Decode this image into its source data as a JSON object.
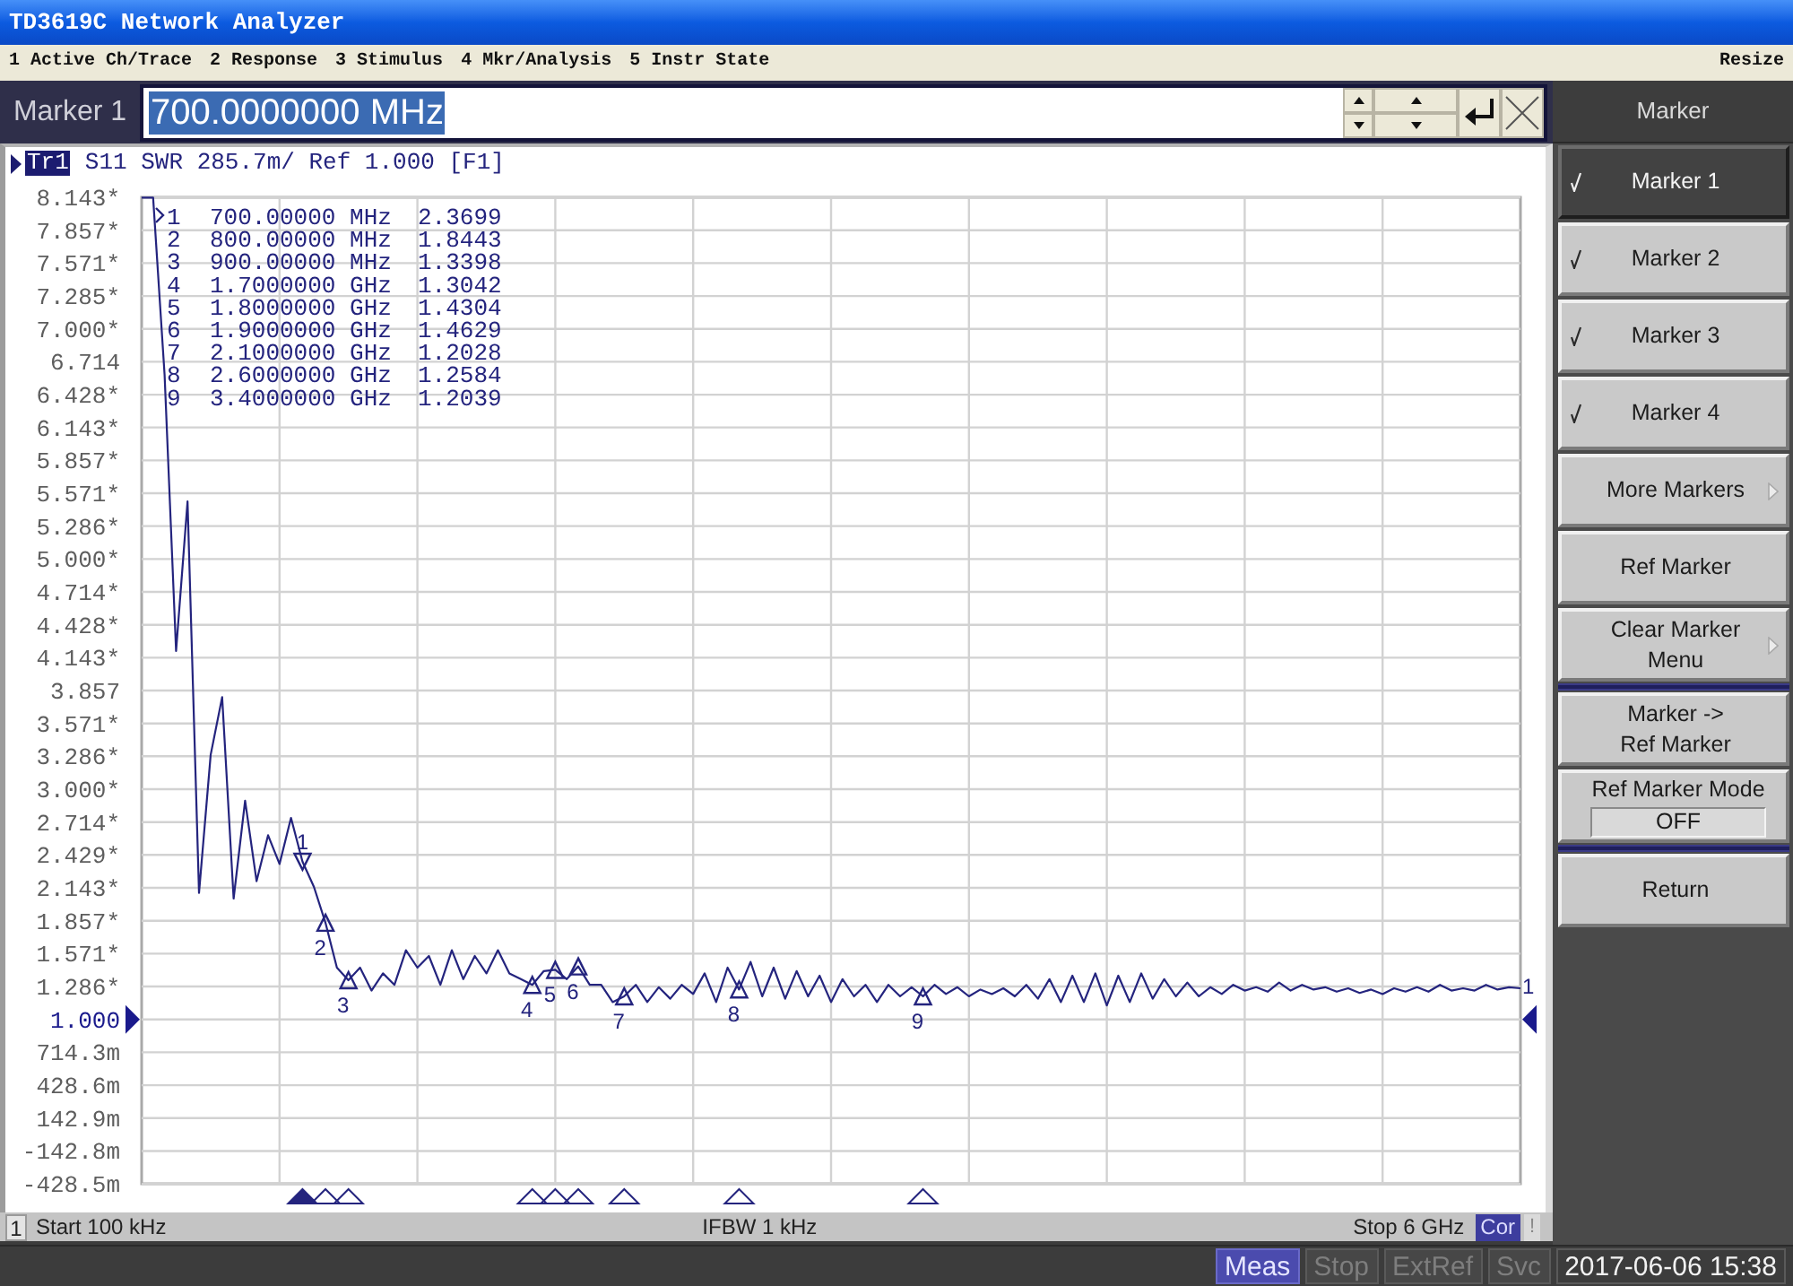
{
  "window": {
    "title": "TD3619C Network Analyzer"
  },
  "menu_bar": {
    "items": [
      "1 Active Ch/Trace",
      "2 Response",
      "3 Stimulus",
      "4 Mkr/Analysis",
      "5 Instr State"
    ],
    "resize": "Resize"
  },
  "entry_bar": {
    "label": "Marker 1",
    "value": "700.0000000 MHz",
    "value_selected": true
  },
  "trace_header": {
    "active": true,
    "trace": "Tr1",
    "info": "S11 SWR 285.7m/ Ref 1.000 [F1]"
  },
  "marker_table": [
    {
      "number": "1",
      "stimulus": "700.00000 MHz",
      "value": "2.3699",
      "active": true
    },
    {
      "number": "2",
      "stimulus": "800.00000 MHz",
      "value": "1.8443",
      "active": false
    },
    {
      "number": "3",
      "stimulus": "900.00000 MHz",
      "value": "1.3398",
      "active": false
    },
    {
      "number": "4",
      "stimulus": "1.7000000 GHz",
      "value": "1.3042",
      "active": false
    },
    {
      "number": "5",
      "stimulus": "1.8000000 GHz",
      "value": "1.4304",
      "active": false
    },
    {
      "number": "6",
      "stimulus": "1.9000000 GHz",
      "value": "1.4629",
      "active": false
    },
    {
      "number": "7",
      "stimulus": "2.1000000 GHz",
      "value": "1.2028",
      "active": false
    },
    {
      "number": "8",
      "stimulus": "2.6000000 GHz",
      "value": "1.2584",
      "active": false
    },
    {
      "number": "9",
      "stimulus": "3.4000000 GHz",
      "value": "1.2039",
      "active": false
    }
  ],
  "chart_data": [
    {
      "type": "line",
      "ylim": [
        -0.4285,
        8.143
      ],
      "tick_labels": "y",
      "grid": true,
      "categories": [
        null,
        null,
        null,
        null,
        null,
        null,
        null,
        null,
        null,
        null,
        null,
        null,
        null,
        null,
        null,
        null,
        null,
        null,
        null,
        null,
        null,
        null,
        null,
        null,
        null,
        null,
        null,
        null,
        null,
        null,
        null,
        null,
        null,
        null,
        null,
        null,
        null,
        null,
        null,
        null,
        null,
        null,
        null,
        null,
        null,
        null,
        null,
        null,
        null,
        null,
        null,
        null,
        null,
        null,
        null,
        null,
        null,
        null,
        null,
        null,
        null,
        null,
        null,
        null,
        null,
        null,
        null,
        null,
        null,
        null,
        null,
        null,
        null,
        null,
        null,
        null,
        null,
        null,
        null,
        null,
        null,
        null,
        null,
        null,
        null,
        null,
        null,
        null,
        null,
        null,
        null,
        null,
        null,
        null,
        null,
        null,
        null,
        null,
        null,
        null,
        null,
        null,
        null,
        null,
        null,
        null,
        null,
        null,
        null,
        null,
        null,
        null,
        null,
        null,
        null,
        null,
        null,
        null,
        null,
        null,
        null
      ],
      "yticks": [
        {
          "value": 8.143,
          "label": "8.143*"
        },
        {
          "value": 7.857,
          "label": "7.857*"
        },
        {
          "value": 7.571,
          "label": "7.571*"
        },
        {
          "value": 7.285,
          "label": "7.285*"
        },
        {
          "value": 7,
          "label": "7.000*"
        },
        {
          "value": 6.714,
          "label": "6.714"
        },
        {
          "value": 6.428,
          "label": "6.428*"
        },
        {
          "value": 6.143,
          "label": "6.143*"
        },
        {
          "value": 5.857,
          "label": "5.857*"
        },
        {
          "value": 5.571,
          "label": "5.571*"
        },
        {
          "value": 5.286,
          "label": "5.286*"
        },
        {
          "value": 5,
          "label": "5.000*"
        },
        {
          "value": 4.714,
          "label": "4.714*"
        },
        {
          "value": 4.428,
          "label": "4.428*"
        },
        {
          "value": 4.143,
          "label": "4.143*"
        },
        {
          "value": 3.857,
          "label": "3.857"
        },
        {
          "value": 3.571,
          "label": "3.571*"
        },
        {
          "value": 3.286,
          "label": "3.286*"
        },
        {
          "value": 3,
          "label": "3.000*"
        },
        {
          "value": 2.714,
          "label": "2.714*"
        },
        {
          "value": 2.429,
          "label": "2.429*"
        },
        {
          "value": 2.143,
          "label": "2.143*"
        },
        {
          "value": 1.857,
          "label": "1.857*"
        },
        {
          "value": 1.571,
          "label": "1.571*"
        },
        {
          "value": 1.286,
          "label": "1.286*"
        },
        {
          "value": 1,
          "label": "1.000"
        }
      ],
      "annotations": [
        "1",
        "2",
        "3",
        "4",
        "5",
        "6",
        "7",
        "8",
        "9"
      ],
      "series": [
        {
          "name": "1",
          "type": "line",
          "color": "#24247e",
          "values": [
            8.14,
            8.14,
            6.6,
            4.2,
            5.5,
            2.1,
            3.3,
            3.8,
            2.05,
            2.9,
            2.2,
            2.6,
            2.35,
            2.75,
            2.37,
            2.15,
            1.84,
            1.45,
            1.34,
            1.45,
            1.25,
            1.4,
            1.3,
            1.6,
            1.45,
            1.55,
            1.3,
            1.6,
            1.35,
            1.55,
            1.4,
            1.6,
            1.4,
            1.35,
            1.3,
            1.42,
            1.43,
            1.35,
            1.46,
            1.3,
            1.3,
            1.15,
            1.2,
            1.3,
            1.15,
            1.28,
            1.18,
            1.3,
            1.22,
            1.4,
            1.15,
            1.45,
            1.26,
            1.5,
            1.2,
            1.45,
            1.18,
            1.42,
            1.2,
            1.38,
            1.15,
            1.35,
            1.2,
            1.3,
            1.15,
            1.3,
            1.2,
            1.28,
            1.2,
            1.3,
            1.22,
            1.28,
            1.2,
            1.26,
            1.22,
            1.27,
            1.2,
            1.3,
            1.18,
            1.35,
            1.15,
            1.38,
            1.15,
            1.4,
            1.12,
            1.38,
            1.15,
            1.4,
            1.18,
            1.35,
            1.2,
            1.32,
            1.2,
            1.28,
            1.22,
            1.3,
            1.25,
            1.28,
            1.24,
            1.32,
            1.25,
            1.3,
            1.26,
            1.28,
            1.24,
            1.27,
            1.23,
            1.26,
            1.22,
            1.27,
            1.24,
            1.28,
            1.24,
            1.3,
            1.25,
            1.27,
            1.25,
            1.3,
            1.26,
            1.28,
            1.27
          ]
        },
        {
          "type": "scatter",
          "marker": "triangle",
          "color": "#24247e",
          "values": [
            null,
            null,
            null,
            null,
            null,
            null,
            null,
            null,
            null,
            null,
            null,
            null,
            null,
            null,
            2.37,
            null,
            1.84,
            null,
            1.34,
            null,
            null,
            null,
            null,
            null,
            null,
            null,
            null,
            null,
            null,
            null,
            null,
            null,
            null,
            null,
            1.3,
            null,
            1.43,
            null,
            1.46,
            null,
            null,
            null,
            1.2,
            null,
            null,
            null,
            null,
            null,
            null,
            null,
            null,
            null,
            1.26,
            null,
            null,
            null,
            null,
            null,
            null,
            null,
            null,
            null,
            null,
            null,
            null,
            null,
            null,
            null,
            1.2,
            null,
            null,
            null,
            null,
            null,
            null,
            null,
            null,
            null,
            null,
            null,
            null,
            null,
            null,
            null,
            null,
            null,
            null,
            null,
            null,
            null,
            null,
            null,
            null,
            null,
            null,
            null,
            null,
            null,
            null,
            null,
            null,
            null,
            null,
            null,
            null,
            null,
            null,
            null,
            null,
            null,
            null,
            null,
            null,
            null,
            null,
            null,
            null,
            null,
            null,
            null,
            null
          ]
        }
      ]
    }
  ],
  "y_axis_milli_labels": [
    "714.3m",
    "428.6m",
    "142.9m",
    "-142.8m",
    "-428.5m"
  ],
  "reference_level": {
    "color": "#1a1a8c"
  },
  "channel_status": {
    "channel": "1",
    "start": "Start 100 kHz",
    "ifbw": "IFBW 1 kHz",
    "stop": "Stop 6 GHz",
    "correction": "Cor",
    "correction_on": true,
    "warning": "!"
  },
  "softkeys": {
    "title": "Marker",
    "items": [
      {
        "kind": "toggle",
        "lines": [
          "Marker 1"
        ],
        "checked": true,
        "selected": true,
        "separator_before": false
      },
      {
        "kind": "toggle",
        "lines": [
          "Marker 2"
        ],
        "checked": true,
        "selected": false,
        "separator_before": false
      },
      {
        "kind": "toggle",
        "lines": [
          "Marker 3"
        ],
        "checked": true,
        "selected": false,
        "separator_before": false
      },
      {
        "kind": "toggle",
        "lines": [
          "Marker 4"
        ],
        "checked": true,
        "selected": false,
        "separator_before": false
      },
      {
        "kind": "submenu",
        "lines": [
          "More Markers"
        ],
        "selected": false,
        "separator_before": false
      },
      {
        "kind": "action",
        "lines": [
          "Ref Marker"
        ],
        "selected": false,
        "separator_before": false
      },
      {
        "kind": "submenu",
        "lines": [
          "Clear Marker",
          "Menu"
        ],
        "selected": false,
        "separator_before": false
      },
      {
        "kind": "action",
        "lines": [
          "Marker ->",
          "Ref Marker"
        ],
        "selected": false,
        "separator_before": true
      },
      {
        "kind": "value",
        "lines": [
          "Ref Marker Mode"
        ],
        "value": "OFF",
        "selected": false,
        "separator_before": false
      },
      {
        "kind": "action",
        "lines": [
          "Return"
        ],
        "selected": false,
        "separator_before": true
      }
    ]
  },
  "status_bar": {
    "indicators": [
      {
        "label": "Meas",
        "on": true
      },
      {
        "label": "Stop",
        "on": false
      },
      {
        "label": "ExtRef",
        "on": false
      },
      {
        "label": "Svc",
        "on": false
      }
    ],
    "datetime": "2017-06-06 15:38"
  }
}
